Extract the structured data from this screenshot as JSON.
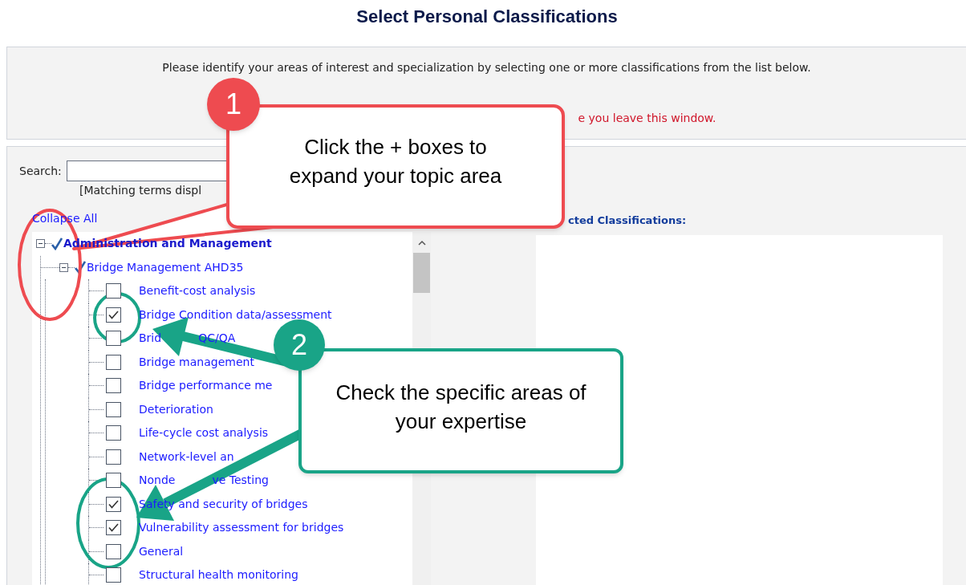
{
  "title": "Select Personal Classifications",
  "intro": {
    "text": "Please identify your areas of interest and specialization by selecting one or more classifications from the list below.",
    "warning": "e you leave this window."
  },
  "search": {
    "label": "Search:",
    "hint": "[Matching terms displ"
  },
  "collapse_all": "Collapse All",
  "tree": [
    {
      "label": "Administration and Management",
      "expanded": true,
      "checked": true,
      "children": [
        {
          "label": "Bridge Management AHD35",
          "expanded": true,
          "checked": true,
          "children": [
            {
              "label": "Benefit-cost analysis",
              "checked": false
            },
            {
              "label": "Bridge Condition data/assessment",
              "checked": true
            },
            {
              "label": "Brid",
              "tail": "QC/QA",
              "checked": false
            },
            {
              "label": "Bridge management",
              "checked": false
            },
            {
              "label": "Bridge performance me",
              "checked": false
            },
            {
              "label": "Deterioration",
              "checked": false
            },
            {
              "label": "Life-cycle cost analysis",
              "checked": false
            },
            {
              "label": "Network-level an",
              "checked": false
            },
            {
              "label": "Nonde",
              "tail": "ve Testing",
              "checked": false
            },
            {
              "label": "Safety and security of bridges",
              "checked": true
            },
            {
              "label": "Vulnerability assessment for bridges",
              "checked": true
            },
            {
              "label": "General",
              "checked": false
            },
            {
              "label": "Structural health monitoring",
              "checked": false
            }
          ]
        }
      ]
    }
  ],
  "selected_panel": {
    "title": "cted Classifications:"
  },
  "callouts": [
    {
      "number": "1",
      "text": "Click the + boxes to expand your topic area",
      "color": "#ee4b50"
    },
    {
      "number": "2",
      "text": "Check the specific areas of your expertise",
      "color": "#19a487"
    }
  ]
}
